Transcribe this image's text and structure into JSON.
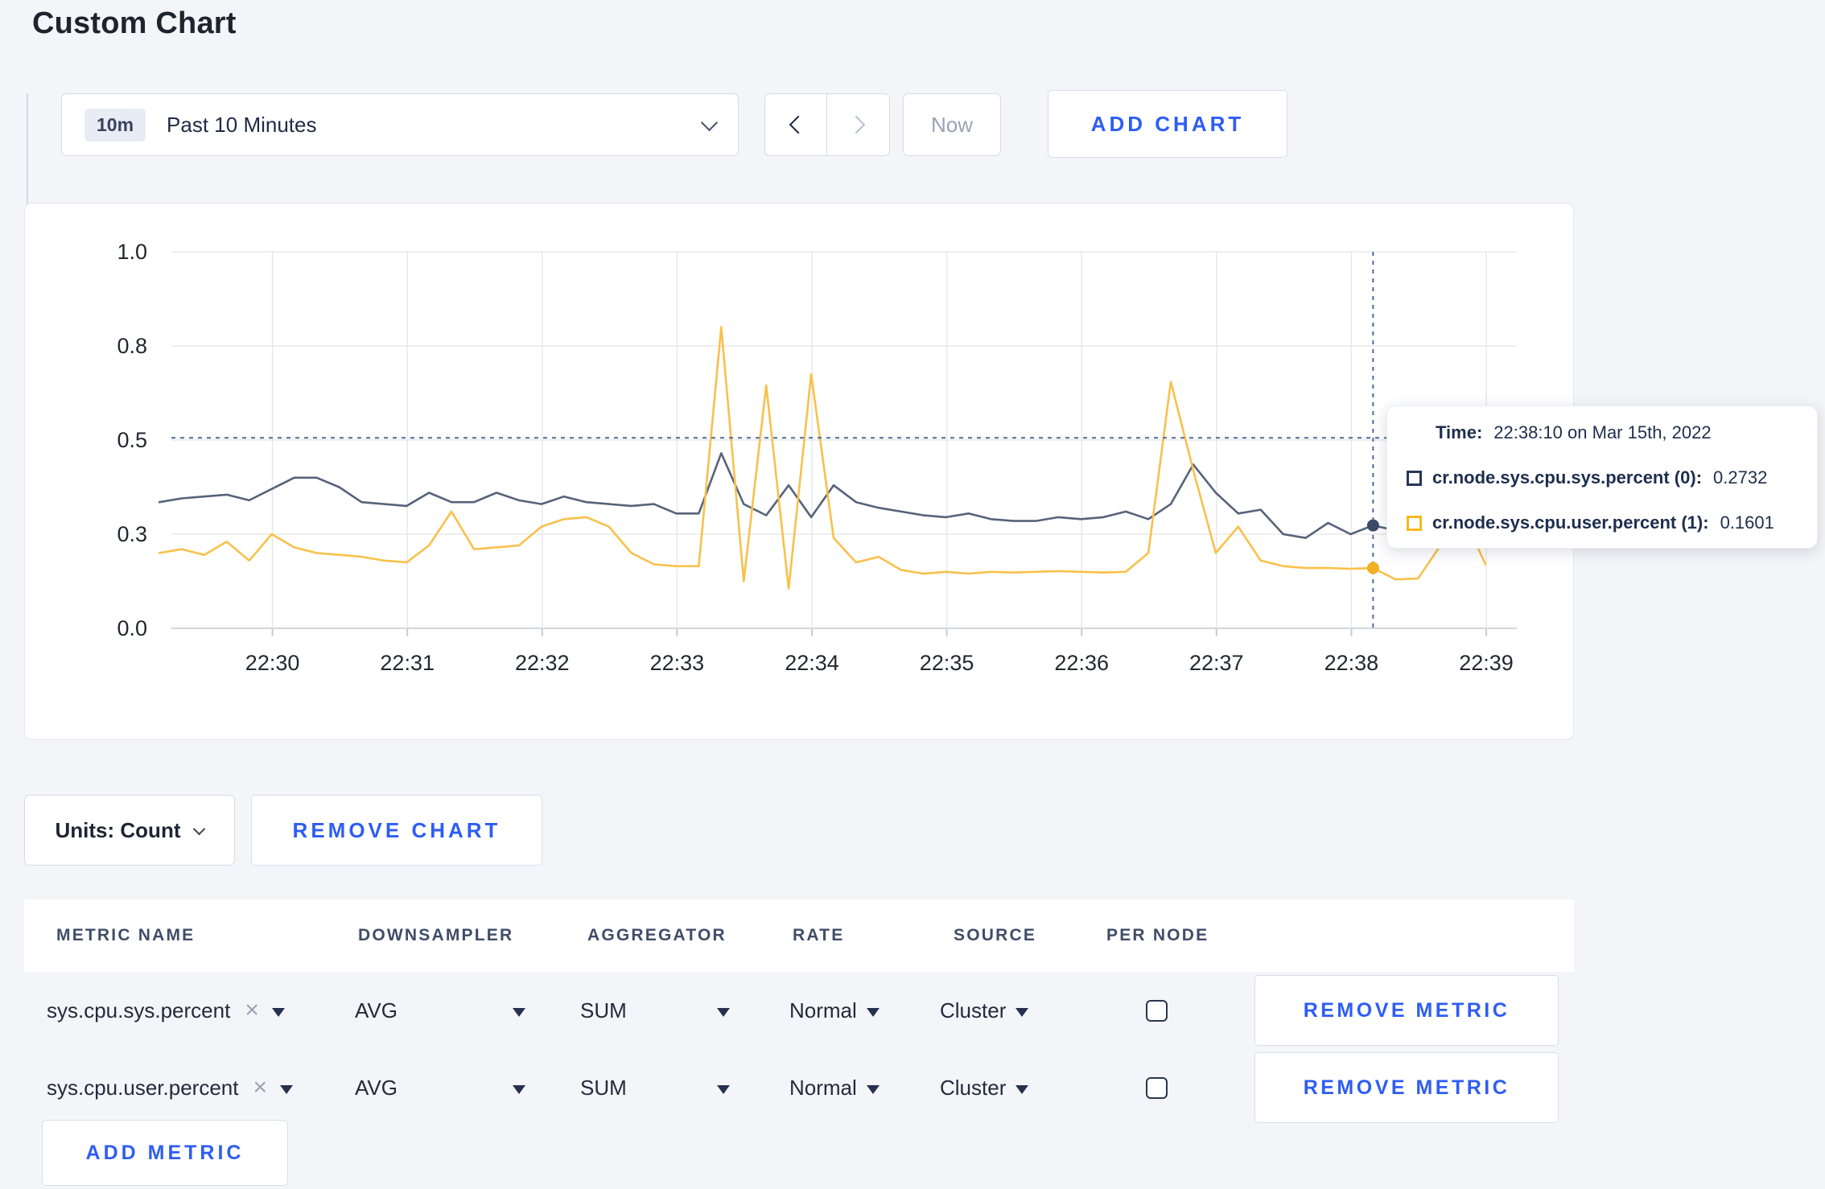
{
  "page": {
    "title": "Custom Chart"
  },
  "colors": {
    "accent_blue": "#2e5df5",
    "series_sys_line": "#566379",
    "series_sys_marker": "#3c4b68",
    "series_user_line": "#f8c14b",
    "series_user_marker": "#f1b123",
    "crosshair": "#4d6c98"
  },
  "icons": {
    "close": "×",
    "chevron_down": "v",
    "chevron_left": "<",
    "chevron_right": ">"
  },
  "toolbar": {
    "time_window_badge": "10m",
    "time_window_label": "Past 10 Minutes",
    "now_label": "Now",
    "add_chart_label": "ADD CHART"
  },
  "tooltip": {
    "time_label": "Time:",
    "time_value": "22:38:10 on Mar 15th, 2022",
    "series": [
      {
        "label": "cr.node.sys.cpu.sys.percent (0):",
        "value": "0.2732",
        "swatch_color": "#26375d"
      },
      {
        "label": "cr.node.sys.cpu.user.percent (1):",
        "value": "0.1601",
        "swatch_color": "#f5b91e"
      }
    ]
  },
  "chart_data": {
    "type": "line",
    "xlabel": "",
    "ylabel": "",
    "ylim": [
      0,
      1
    ],
    "grid": true,
    "x_ticks": [
      "22:30",
      "22:31",
      "22:32",
      "22:33",
      "22:34",
      "22:35",
      "22:36",
      "22:37",
      "22:38",
      "22:39"
    ],
    "y_ticks": {
      "positions": [
        0,
        0.25,
        0.5,
        0.75,
        1.0
      ],
      "labels": [
        "0.0",
        "0.3",
        "0.5",
        "0.8",
        "1.0"
      ]
    },
    "point_interval_seconds": 10,
    "crosshair": {
      "time": "22:38:10",
      "point_index": 54,
      "hover_value": 0.506
    },
    "series": [
      {
        "name": "cr.node.sys.cpu.sys.percent (0)",
        "color": "#566379",
        "marker_color": "#3c4b68",
        "value_at_crosshair": 0.2732,
        "values": [
          0.335,
          0.345,
          0.35,
          0.355,
          0.34,
          0.37,
          0.4,
          0.4,
          0.375,
          0.335,
          0.33,
          0.325,
          0.36,
          0.335,
          0.335,
          0.36,
          0.34,
          0.33,
          0.35,
          0.335,
          0.33,
          0.325,
          0.33,
          0.305,
          0.305,
          0.465,
          0.33,
          0.3,
          0.38,
          0.295,
          0.38,
          0.335,
          0.32,
          0.31,
          0.3,
          0.295,
          0.305,
          0.29,
          0.285,
          0.285,
          0.295,
          0.29,
          0.295,
          0.31,
          0.29,
          0.33,
          0.435,
          0.36,
          0.305,
          0.315,
          0.25,
          0.24,
          0.28,
          0.25,
          0.2732,
          0.26,
          0.29,
          0.29,
          0.3,
          0.3
        ]
      },
      {
        "name": "cr.node.sys.cpu.user.percent (1)",
        "color": "#f8c14b",
        "marker_color": "#f1b123",
        "value_at_crosshair": 0.1601,
        "values": [
          0.2,
          0.21,
          0.195,
          0.23,
          0.18,
          0.25,
          0.215,
          0.2,
          0.195,
          0.19,
          0.18,
          0.175,
          0.22,
          0.31,
          0.21,
          0.215,
          0.22,
          0.27,
          0.29,
          0.295,
          0.27,
          0.2,
          0.17,
          0.165,
          0.165,
          0.8,
          0.125,
          0.645,
          0.105,
          0.675,
          0.24,
          0.175,
          0.19,
          0.155,
          0.145,
          0.15,
          0.145,
          0.15,
          0.148,
          0.15,
          0.152,
          0.15,
          0.148,
          0.15,
          0.2,
          0.655,
          0.42,
          0.2,
          0.27,
          0.18,
          0.165,
          0.16,
          0.16,
          0.158,
          0.1601,
          0.13,
          0.132,
          0.22,
          0.3,
          0.17
        ]
      }
    ]
  },
  "units_bar": {
    "units_label": "Units: Count",
    "remove_chart_label": "REMOVE CHART"
  },
  "metrics_table": {
    "headers": [
      "METRIC NAME",
      "DOWNSAMPLER",
      "AGGREGATOR",
      "RATE",
      "SOURCE",
      "PER NODE"
    ],
    "remove_metric_label": "REMOVE METRIC",
    "add_metric_label": "ADD METRIC",
    "rows": [
      {
        "metric_name": "sys.cpu.sys.percent",
        "downsampler": "AVG",
        "aggregator": "SUM",
        "rate": "Normal",
        "source": "Cluster",
        "per_node_checked": false
      },
      {
        "metric_name": "sys.cpu.user.percent",
        "downsampler": "AVG",
        "aggregator": "SUM",
        "rate": "Normal",
        "source": "Cluster",
        "per_node_checked": false
      }
    ]
  }
}
